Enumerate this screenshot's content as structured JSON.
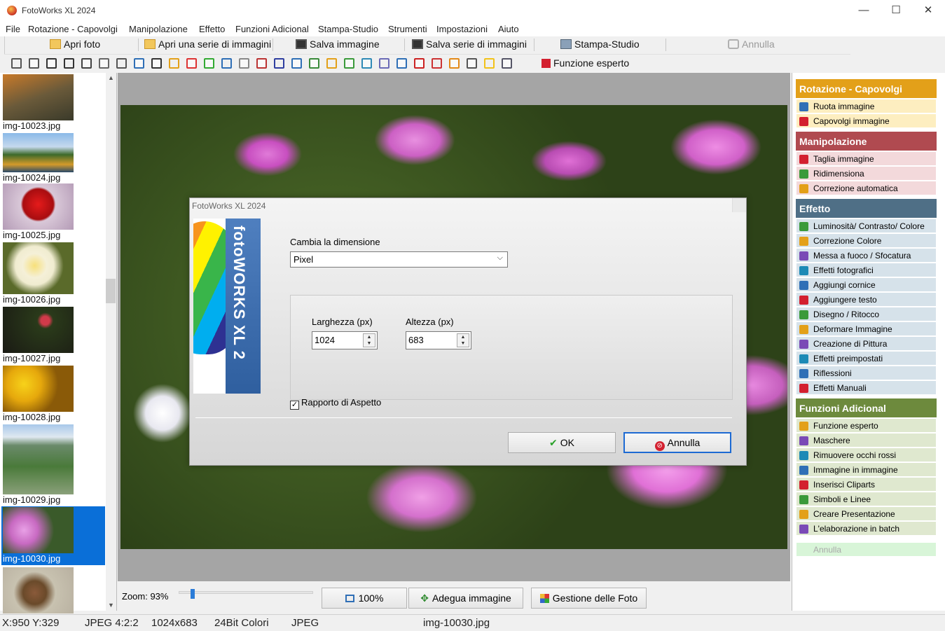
{
  "window": {
    "title": "FotoWorks XL 2024",
    "minimize": "—",
    "maximize": "☐",
    "close": "✕"
  },
  "menu": [
    "File",
    "Rotazione - Capovolgi",
    "Manipolazione",
    "Effetto",
    "Funzioni Adicional",
    "Stampa-Studio",
    "Strumenti",
    "Impostazioni",
    "Aiuto"
  ],
  "toolbar": {
    "open": "Apri foto",
    "open_series": "Apri una serie di immagini",
    "save": "Salva immagine",
    "save_series": "Salva serie di immagini",
    "print": "Stampa-Studio",
    "undo": "Annulla",
    "expert": "Funzione esperto"
  },
  "thumbnails": [
    "img-10023.jpg",
    "img-10024.jpg",
    "img-10025.jpg",
    "img-10026.jpg",
    "img-10027.jpg",
    "img-10028.jpg",
    "img-10029.jpg",
    "img-10030.jpg"
  ],
  "selected_thumbnail": "img-10030.jpg",
  "dialog": {
    "title": "FotoWorks XL 2024",
    "banner": "fotoWORKS XL 2",
    "size_label": "Cambia la dimensione",
    "unit": "Pixel",
    "width_label": "Larghezza (px)",
    "width_value": "1024",
    "height_label": "Altezza (px)",
    "height_value": "683",
    "aspect_label": "Rapporto di Aspetto",
    "aspect_checked": true,
    "ok": "OK",
    "cancel": "Annulla"
  },
  "zoom": {
    "label": "Zoom: 93%",
    "value_percent": 93,
    "btn_100": "100%",
    "btn_fit": "Adegua immagine",
    "btn_manage": "Gestione delle Foto"
  },
  "panel": {
    "rotation": {
      "title": "Rotazione - Capovolgi",
      "color": "#e3a019",
      "item_bg": "#fdeec0",
      "items": [
        "Ruota immagine",
        "Capovolgi immagine"
      ]
    },
    "manipulation": {
      "title": "Manipolazione",
      "color": "#b04a50",
      "item_bg": "#f3d9db",
      "items": [
        "Taglia immagine",
        "Ridimensiona",
        "Correzione automatica"
      ]
    },
    "effect": {
      "title": "Effetto",
      "color": "#4f6f86",
      "item_bg": "#d6e2ea",
      "items": [
        "Luminosità/ Contrasto/ Colore",
        "Correzione Colore",
        "Messa a fuoco / Sfocatura",
        "Effetti fotografici",
        "Aggiungi cornice",
        "Aggiungere testo",
        "Disegno / Ritocco",
        "Deformare Immagine",
        "Creazione di Pittura",
        "Effetti preimpostati",
        "Riflessioni",
        "Effetti Manuali"
      ]
    },
    "additional": {
      "title": "Funzioni Adicional",
      "color": "#6d8a3d",
      "item_bg": "#dfe8cf",
      "items": [
        "Funzione esperto",
        "Maschere",
        "Rimuovere occhi rossi",
        "Immagine in immagine",
        "Inserisci Cliparts",
        "Simboli e Linee",
        "Creare Presentazione",
        "L'elaborazione in batch"
      ]
    },
    "undo": "Annulla"
  },
  "status": {
    "coords": "X:950 Y:329",
    "format": "JPEG  4:2:2",
    "dimensions": "1024x683",
    "colors": "24Bit Colori",
    "type": "JPEG",
    "file": "img-10030.jpg"
  }
}
